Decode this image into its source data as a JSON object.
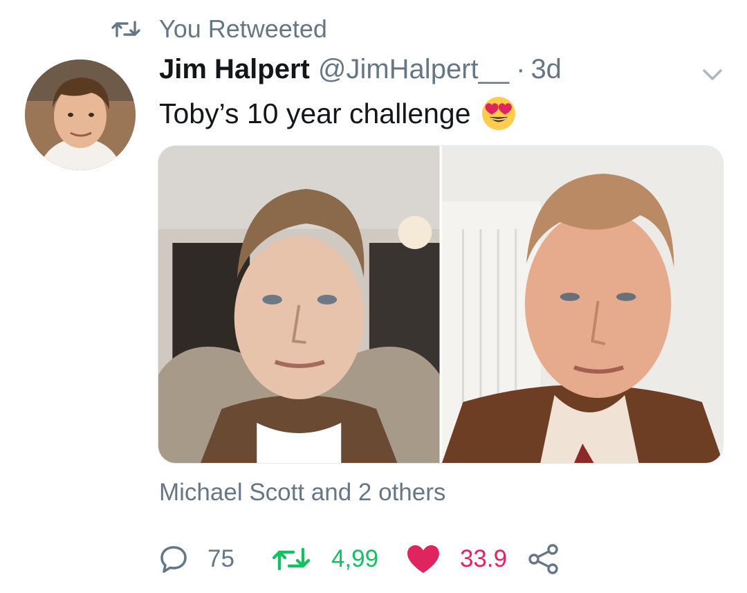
{
  "retweet_context": {
    "icon": "retweet-icon",
    "text": "You Retweeted"
  },
  "tweet": {
    "author_name": "Jim Halpert",
    "author_handle": "@JimHalpert__",
    "separator": "·",
    "time": "3d",
    "text": "Toby’s 10 year challenge",
    "emoji": "smiling-face-with-heart-eyes-emoji",
    "avatar": "avatar-photo",
    "menu_icon": "chevron-down-icon",
    "media": [
      {
        "name": "photo-left"
      },
      {
        "name": "photo-right"
      }
    ]
  },
  "social_context": {
    "text": "Michael Scott and 2 others"
  },
  "actions": {
    "reply": {
      "icon": "reply-icon",
      "count": "75"
    },
    "retweet": {
      "icon": "retweet-icon",
      "count": "4,99",
      "color": "#17bf63"
    },
    "like": {
      "icon": "heart-icon",
      "count": "33.9",
      "color": "#e0245e"
    },
    "share": {
      "icon": "share-icon"
    }
  },
  "colors": {
    "secondary_text": "#657786",
    "primary_text": "#14171a",
    "retweet_green": "#17bf63",
    "like_red": "#e0245e"
  }
}
